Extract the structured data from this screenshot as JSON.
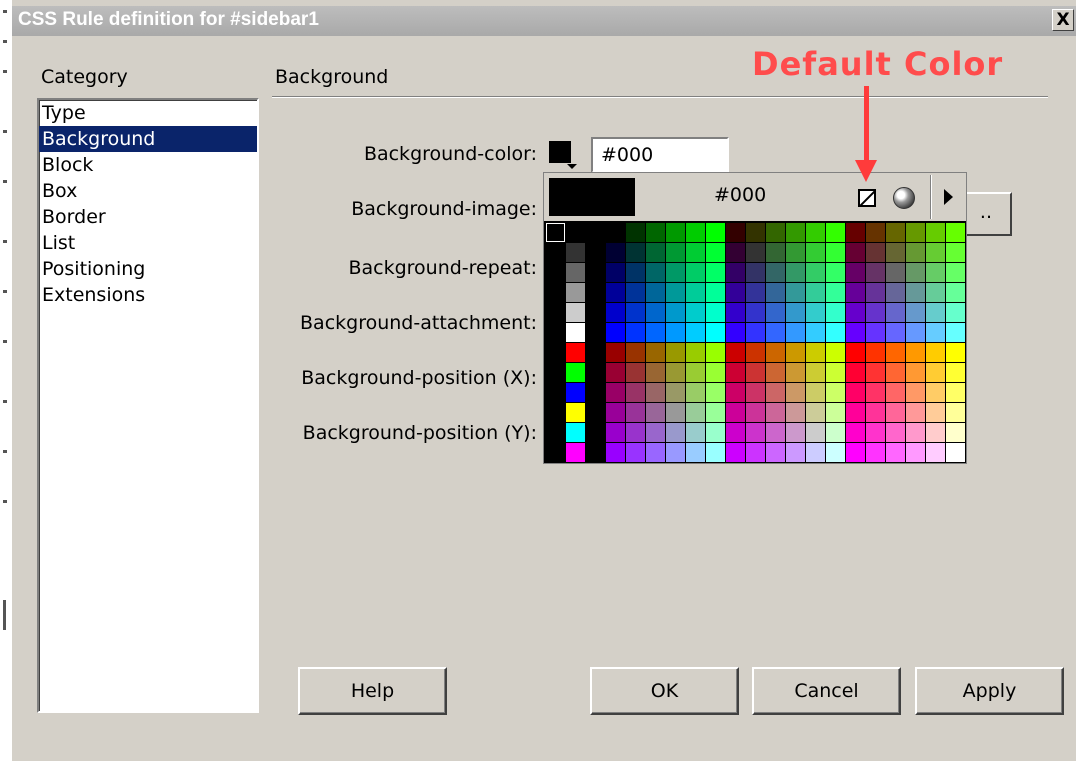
{
  "window": {
    "title": "CSS Rule definition for #sidebar1",
    "close_label": "X"
  },
  "category": {
    "label": "Category",
    "items": [
      "Type",
      "Background",
      "Block",
      "Box",
      "Border",
      "List",
      "Positioning",
      "Extensions"
    ],
    "selected": "Background"
  },
  "panel": {
    "title": "Background",
    "fields": {
      "color_label": "Background-color:",
      "image_label": "Background-image:",
      "repeat_label": "Background-repeat:",
      "attachment_label": "Background-attachment:",
      "position_x_label": "Background-position (X):",
      "position_y_label": "Background-position (Y):"
    },
    "color_value": "#000",
    "browse_label": ".."
  },
  "color_picker": {
    "current_hex": "#000",
    "preview_color": "#000000",
    "default_color_icon": "default-color-icon",
    "system_color_icon": "globe-icon",
    "menu_icon": "right-arrow-icon",
    "palette": "web-safe-216"
  },
  "buttons": {
    "help": "Help",
    "ok": "OK",
    "cancel": "Cancel",
    "apply": "Apply"
  },
  "annotation": {
    "text": "Default Color",
    "color": "#ff4c4c"
  }
}
